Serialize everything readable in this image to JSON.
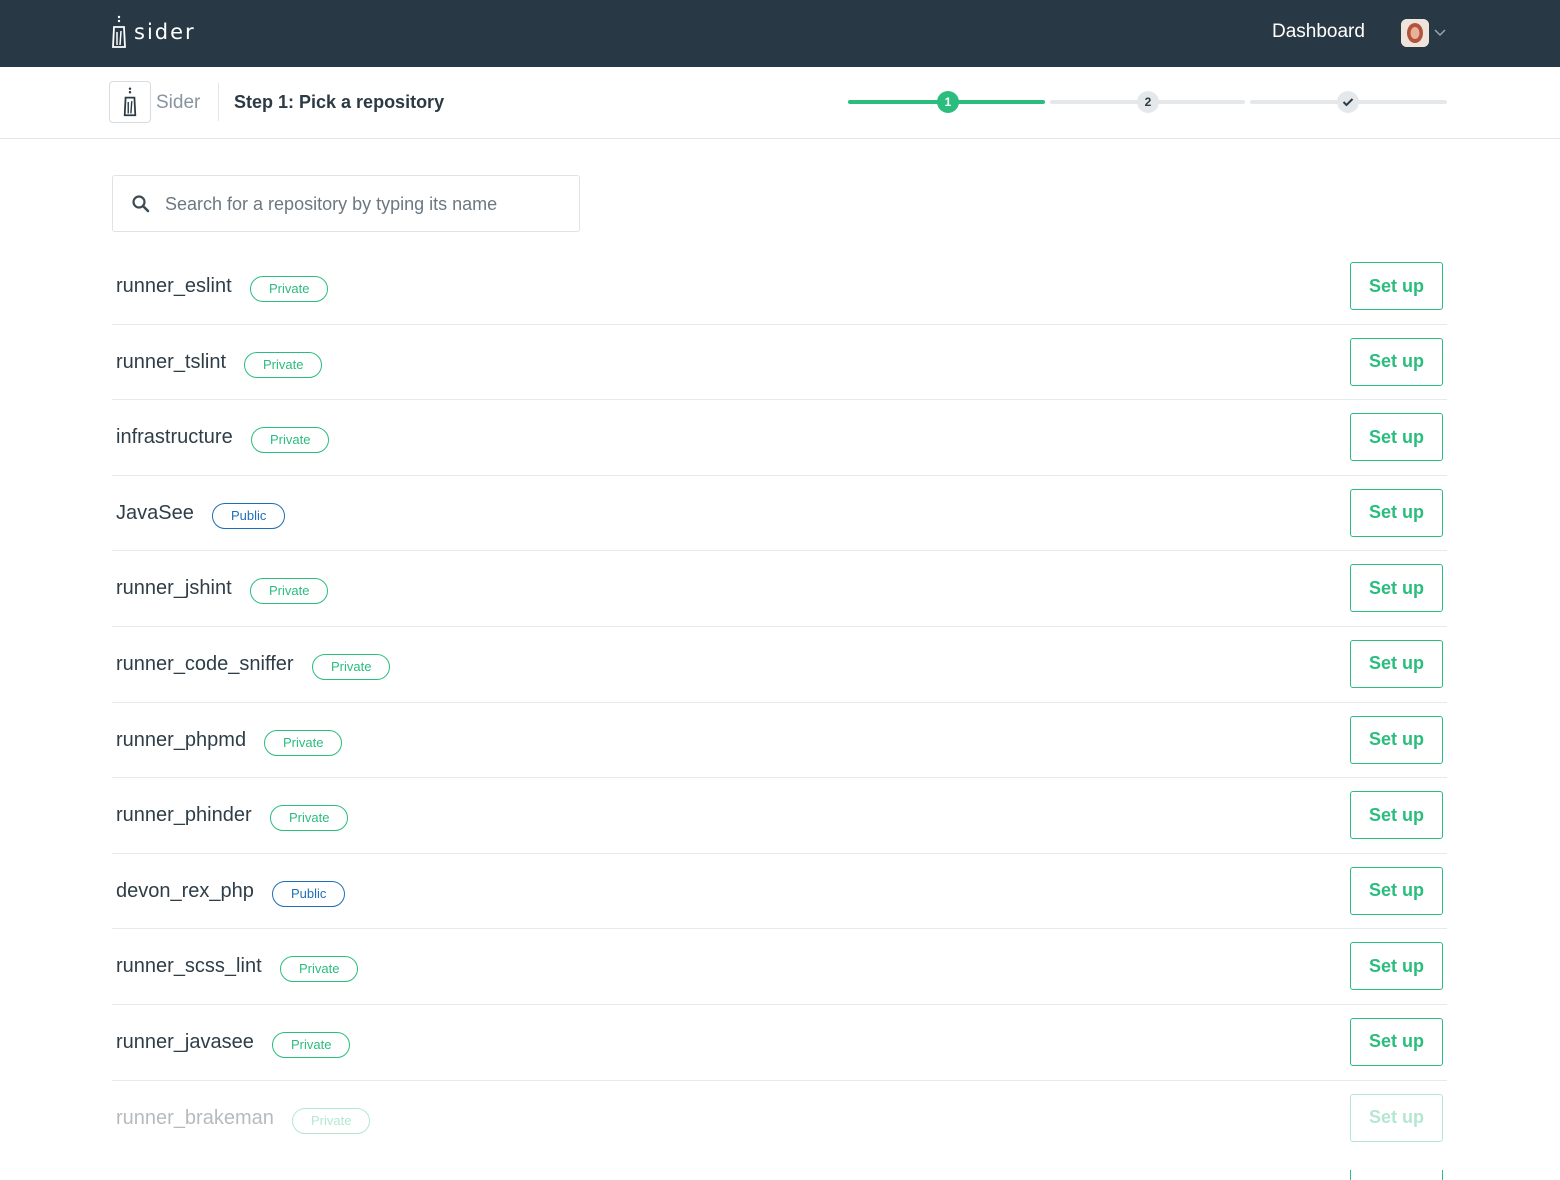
{
  "brand": {
    "name": "sider"
  },
  "nav": {
    "dashboard_label": "Dashboard"
  },
  "step": {
    "org_name": "Sider",
    "title": "Step 1: Pick a repository",
    "steps": [
      "1",
      "2",
      "✓"
    ],
    "current": 1
  },
  "search": {
    "placeholder": "Search for a repository by typing its name",
    "value": ""
  },
  "colors": {
    "accent": "#2bbd7e",
    "public": "#1e6fb8",
    "nav_bg": "#283845"
  },
  "button_label": "Set up",
  "repos": [
    {
      "name": "runner_eslint",
      "visibility": "Private"
    },
    {
      "name": "runner_tslint",
      "visibility": "Private"
    },
    {
      "name": "infrastructure",
      "visibility": "Private"
    },
    {
      "name": "JavaSee",
      "visibility": "Public"
    },
    {
      "name": "runner_jshint",
      "visibility": "Private"
    },
    {
      "name": "runner_code_sniffer",
      "visibility": "Private"
    },
    {
      "name": "runner_phpmd",
      "visibility": "Private"
    },
    {
      "name": "runner_phinder",
      "visibility": "Private"
    },
    {
      "name": "devon_rex_php",
      "visibility": "Public"
    },
    {
      "name": "runner_scss_lint",
      "visibility": "Private"
    },
    {
      "name": "runner_javasee",
      "visibility": "Private"
    },
    {
      "name": "runner_brakeman",
      "visibility": "Private"
    }
  ]
}
